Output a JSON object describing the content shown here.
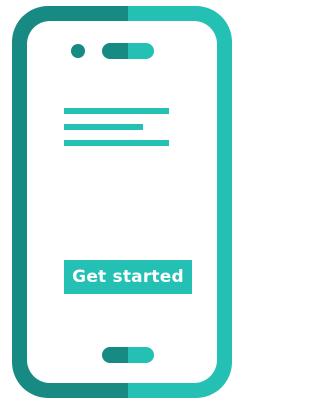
{
  "illustration": {
    "subject": "smartphone-icon",
    "colors": {
      "dark_teal": "#178a84",
      "light_teal": "#25c0b4",
      "screen": "#ffffff"
    }
  },
  "screen": {
    "cta_label": "Get started"
  }
}
